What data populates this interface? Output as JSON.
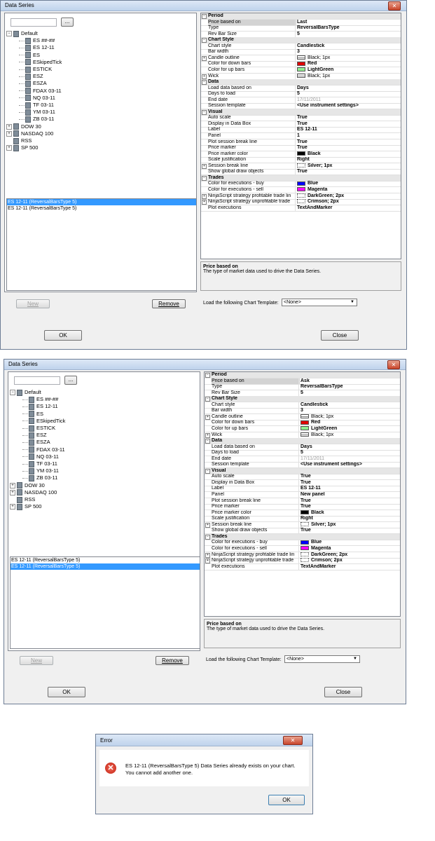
{
  "window1": {
    "title": "Data Series",
    "close_glyph": "✕",
    "browse_label": "...",
    "tree": [
      {
        "label": "Default",
        "level": 0,
        "exp": "−",
        "folder": true
      },
      {
        "label": "ES ##-##",
        "level": 1
      },
      {
        "label": "ES 12-11",
        "level": 1
      },
      {
        "label": "ES",
        "level": 1
      },
      {
        "label": "ESkipedTick",
        "level": 1
      },
      {
        "label": "ESTICK",
        "level": 1
      },
      {
        "label": "ESZ",
        "level": 1
      },
      {
        "label": "ESZA",
        "level": 1
      },
      {
        "label": "FDAX 03-11",
        "level": 1
      },
      {
        "label": "NQ 03-11",
        "level": 1
      },
      {
        "label": "TF 03-11",
        "level": 1
      },
      {
        "label": "YM 03-11",
        "level": 1
      },
      {
        "label": "ZB 03-11",
        "level": 1
      },
      {
        "label": "DOW 30",
        "level": 0,
        "exp": "+",
        "folder": true
      },
      {
        "label": "NASDAQ 100",
        "level": 0,
        "exp": "+",
        "folder": true
      },
      {
        "label": "RSS",
        "level": 0,
        "folder": true
      },
      {
        "label": "SP 500",
        "level": 0,
        "exp": "+",
        "folder": true
      }
    ],
    "series_list": [
      {
        "label": "ES 12-11 (ReversalBarsType 5)",
        "selected": true
      },
      {
        "label": "ES 12-11 (ReversalBarsType 5)",
        "selected": false
      }
    ],
    "new_label": "New",
    "remove_label": "Remove",
    "ok_label": "OK",
    "close_label": "Close",
    "template_label": "Load the following Chart Template:",
    "template_value": "<None>",
    "desc_title": "Price based on",
    "desc_text": "The type of market data used to drive the Data Series.",
    "props": [
      {
        "cat": true,
        "label": "Period"
      },
      {
        "label": "Price based on",
        "value": "Last",
        "sel": true
      },
      {
        "label": "Type",
        "value": "ReversalBarsType"
      },
      {
        "label": "Rev Bar Size",
        "value": "5"
      },
      {
        "cat": true,
        "label": "Chart Style"
      },
      {
        "label": "Chart style",
        "value": "Candlestick"
      },
      {
        "label": "Bar width",
        "value": "3"
      },
      {
        "label": "Candle outline",
        "value": "Black; 1px",
        "exp": "+",
        "swatch": "line",
        "light": true
      },
      {
        "label": "Color for down bars",
        "value": "Red",
        "swatch": "#e00000"
      },
      {
        "label": "Color for up bars",
        "value": "LightGreen",
        "swatch": "#90ee90"
      },
      {
        "label": "Wick",
        "value": "Black; 1px",
        "exp": "+",
        "swatch": "line",
        "light": true
      },
      {
        "cat": true,
        "label": "Data"
      },
      {
        "label": "Load data based on",
        "value": "Days"
      },
      {
        "label": "Days to load",
        "value": "5"
      },
      {
        "label": "End date",
        "value": "17/11/2011",
        "grey": true
      },
      {
        "label": "Session template",
        "value": "<Use instrument settings>"
      },
      {
        "cat": true,
        "label": "Visual"
      },
      {
        "label": "Auto scale",
        "value": "True"
      },
      {
        "label": "Display in Data Box",
        "value": "True"
      },
      {
        "label": "Label",
        "value": "ES 12-11"
      },
      {
        "label": "Panel",
        "value": "1"
      },
      {
        "label": "Plot session break line",
        "value": "True"
      },
      {
        "label": "Price marker",
        "value": "True"
      },
      {
        "label": "Price marker color",
        "value": "Black",
        "swatch": "#000000"
      },
      {
        "label": "Scale justification",
        "value": "Right"
      },
      {
        "label": "Session break line",
        "value": "Silver; 1px",
        "exp": "+",
        "swatch": "dotted"
      },
      {
        "label": "Show global draw objects",
        "value": "True"
      },
      {
        "cat": true,
        "label": "Trades"
      },
      {
        "label": "Color for executions - buy",
        "value": "Blue",
        "swatch": "#0000ff"
      },
      {
        "label": "Color for executions - sell",
        "value": "Magenta",
        "swatch": "#ff00ff"
      },
      {
        "label": "NinjaScript strategy profitable trade lin",
        "value": "DarkGreen; 2px",
        "exp": "+",
        "swatch": "dotted"
      },
      {
        "label": "NinjaScript strategy unprofitable trade",
        "value": "Crimson; 2px",
        "exp": "+",
        "swatch": "dotted"
      },
      {
        "label": "Plot executions",
        "value": "TextAndMarker"
      }
    ]
  },
  "window2": {
    "title": "Data Series",
    "close_glyph": "✕",
    "browse_label": "...",
    "series_list": [
      {
        "label": "ES 12-11 (ReversalBarsType 5)",
        "selected": false
      },
      {
        "label": "ES 12-11 (ReversalBarsType 5)",
        "selected": true
      }
    ],
    "new_label": "New",
    "remove_label": "Remove",
    "ok_label": "OK",
    "close_label": "Close",
    "template_label": "Load the following Chart Template:",
    "template_value": "<None>",
    "desc_title": "Price based on",
    "desc_text": "The type of market data used to drive the Data Series.",
    "price_based_on": "Ask",
    "panel": "New panel"
  },
  "error_dialog": {
    "title": "Error",
    "close_glyph": "✕",
    "icon_glyph": "✕",
    "message_line1": "ES 12-11 (ReversalBarsType 5) Data Series already exists on your chart.",
    "message_line2": "You cannot add another one.",
    "ok_label": "OK"
  }
}
